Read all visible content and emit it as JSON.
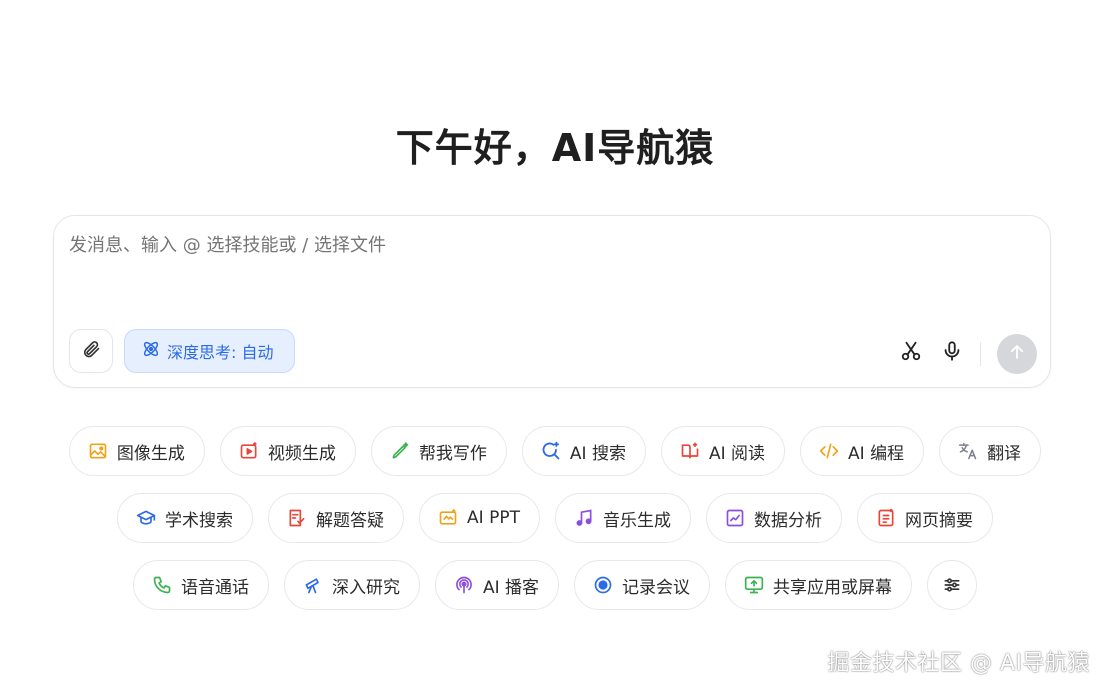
{
  "greeting": "下午好，AI导航猿",
  "composer": {
    "placeholder": "发消息、输入 @ 选择技能或 / 选择文件",
    "deep_think_label": "深度思考: 自动",
    "icons": [
      "paperclip-icon",
      "atom-icon",
      "scissors-icon",
      "microphone-icon",
      "arrow-up-icon"
    ]
  },
  "skills": {
    "row1": [
      {
        "label": "图像生成",
        "icon": "image-icon",
        "color": "#f0a21a"
      },
      {
        "label": "视频生成",
        "icon": "video-icon",
        "color": "#e8463a"
      },
      {
        "label": "帮我写作",
        "icon": "pen-icon",
        "color": "#3ab24f"
      },
      {
        "label": "AI 搜索",
        "icon": "search-icon",
        "color": "#2b6be6"
      },
      {
        "label": "AI 阅读",
        "icon": "book-icon",
        "color": "#e8463a"
      },
      {
        "label": "AI 编程",
        "icon": "code-icon",
        "color": "#f0a21a"
      },
      {
        "label": "翻译",
        "icon": "translate-icon",
        "color": "#7a7f8c"
      }
    ],
    "row2": [
      {
        "label": "学术搜索",
        "icon": "graduation-cap-icon",
        "color": "#2b6be6"
      },
      {
        "label": "解题答疑",
        "icon": "quiz-icon",
        "color": "#e8463a"
      },
      {
        "label": "AI PPT",
        "icon": "slides-icon",
        "color": "#f0a21a"
      },
      {
        "label": "音乐生成",
        "icon": "music-icon",
        "color": "#8b4fe0"
      },
      {
        "label": "数据分析",
        "icon": "chart-icon",
        "color": "#8b4fe0"
      },
      {
        "label": "网页摘要",
        "icon": "webpage-icon",
        "color": "#e8463a"
      }
    ],
    "row3": [
      {
        "label": "语音通话",
        "icon": "phone-icon",
        "color": "#3ab24f"
      },
      {
        "label": "深入研究",
        "icon": "telescope-icon",
        "color": "#2b6be6"
      },
      {
        "label": "AI 播客",
        "icon": "podcast-icon",
        "color": "#8b4fe0"
      },
      {
        "label": "记录会议",
        "icon": "record-icon",
        "color": "#2b6be6"
      },
      {
        "label": "共享应用或屏幕",
        "icon": "screen-share-icon",
        "color": "#3ab24f"
      }
    ],
    "more_icon": "sliders-icon"
  },
  "watermark": "掘金技术社区 @ AI导航猿"
}
